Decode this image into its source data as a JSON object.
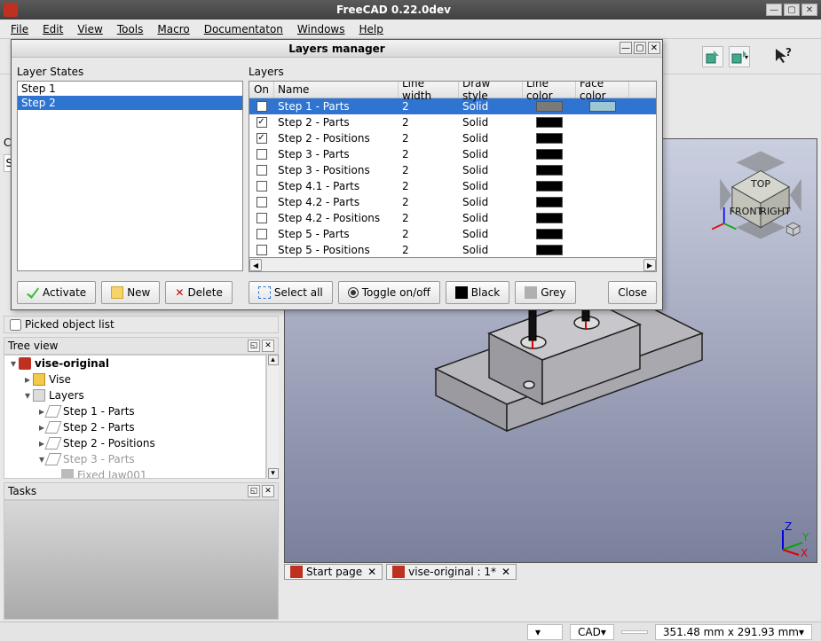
{
  "app": {
    "title": "FreeCAD 0.22.0dev"
  },
  "menu": [
    "File",
    "Edit",
    "View",
    "Tools",
    "Macro",
    "Documentaton",
    "Windows",
    "Help"
  ],
  "dialog": {
    "title": "Layers manager",
    "states_label": "Layer States",
    "layers_label": "Layers",
    "states": [
      {
        "name": "Step 1",
        "selected": false
      },
      {
        "name": "Step 2",
        "selected": true
      }
    ],
    "columns": {
      "on": "On",
      "name": "Name",
      "lw": "Line width",
      "ds": "Draw style",
      "lc": "Line color",
      "fc": "Face color"
    },
    "rows": [
      {
        "on": true,
        "name": "Step 1 - Parts",
        "lw": "2",
        "ds": "Solid",
        "lc": "#7a7a7a",
        "fc": "#9ec7d6",
        "sel": true
      },
      {
        "on": true,
        "name": "Step 2 - Parts",
        "lw": "2",
        "ds": "Solid",
        "lc": "#000000",
        "fc": "",
        "sel": false
      },
      {
        "on": true,
        "name": "Step 2 - Positions",
        "lw": "2",
        "ds": "Solid",
        "lc": "#000000",
        "fc": "",
        "sel": false
      },
      {
        "on": false,
        "name": "Step 3 - Parts",
        "lw": "2",
        "ds": "Solid",
        "lc": "#000000",
        "fc": "",
        "sel": false
      },
      {
        "on": false,
        "name": "Step 3 - Positions",
        "lw": "2",
        "ds": "Solid",
        "lc": "#000000",
        "fc": "",
        "sel": false
      },
      {
        "on": false,
        "name": "Step 4.1 - Parts",
        "lw": "2",
        "ds": "Solid",
        "lc": "#000000",
        "fc": "",
        "sel": false
      },
      {
        "on": false,
        "name": "Step 4.2 - Parts",
        "lw": "2",
        "ds": "Solid",
        "lc": "#000000",
        "fc": "",
        "sel": false
      },
      {
        "on": false,
        "name": "Step 4.2 - Positions",
        "lw": "2",
        "ds": "Solid",
        "lc": "#000000",
        "fc": "",
        "sel": false
      },
      {
        "on": false,
        "name": "Step 5 - Parts",
        "lw": "2",
        "ds": "Solid",
        "lc": "#000000",
        "fc": "",
        "sel": false
      },
      {
        "on": false,
        "name": "Step 5 - Positions",
        "lw": "2",
        "ds": "Solid",
        "lc": "#000000",
        "fc": "",
        "sel": false
      }
    ],
    "buttons": {
      "activate": "Activate",
      "new": "New",
      "delete": "Delete",
      "select_all": "Select all",
      "toggle": "Toggle on/off",
      "black": "Black",
      "grey": "Grey",
      "close": "Close"
    }
  },
  "sidepanel": {
    "picked_label": "Picked object list",
    "treeview_label": "Tree view",
    "tasks_label": "Tasks",
    "combo_label": "C",
    "search_stub": "Se",
    "root": "vise-original",
    "tree": [
      {
        "indent": 1,
        "arrow": "▸",
        "icon": "cube",
        "label": "Vise"
      },
      {
        "indent": 1,
        "arrow": "▾",
        "icon": "layers",
        "label": "Layers"
      },
      {
        "indent": 2,
        "arrow": "▸",
        "icon": "layer",
        "label": "Step 1 - Parts"
      },
      {
        "indent": 2,
        "arrow": "▸",
        "icon": "layer",
        "label": "Step 2 - Parts"
      },
      {
        "indent": 2,
        "arrow": "▸",
        "icon": "layer",
        "label": "Step 2 - Positions"
      },
      {
        "indent": 2,
        "arrow": "▾",
        "icon": "layer",
        "label": "Step 3 - Parts",
        "grey": true
      },
      {
        "indent": 3,
        "arrow": "",
        "icon": "fixed",
        "label": "Fixed Jaw001",
        "grey": true
      }
    ]
  },
  "tabs": [
    {
      "label": "Start page",
      "close": true
    },
    {
      "label": "vise-original : 1*",
      "close": true
    }
  ],
  "status": {
    "fields": [
      "",
      "CAD",
      "",
      "351.48 mm x 291.93 mm"
    ],
    "dropdown_icon": "▾"
  },
  "navcube": {
    "top": "TOP",
    "front": "FRONT",
    "right": "RIGHT"
  },
  "tool_help": "?"
}
